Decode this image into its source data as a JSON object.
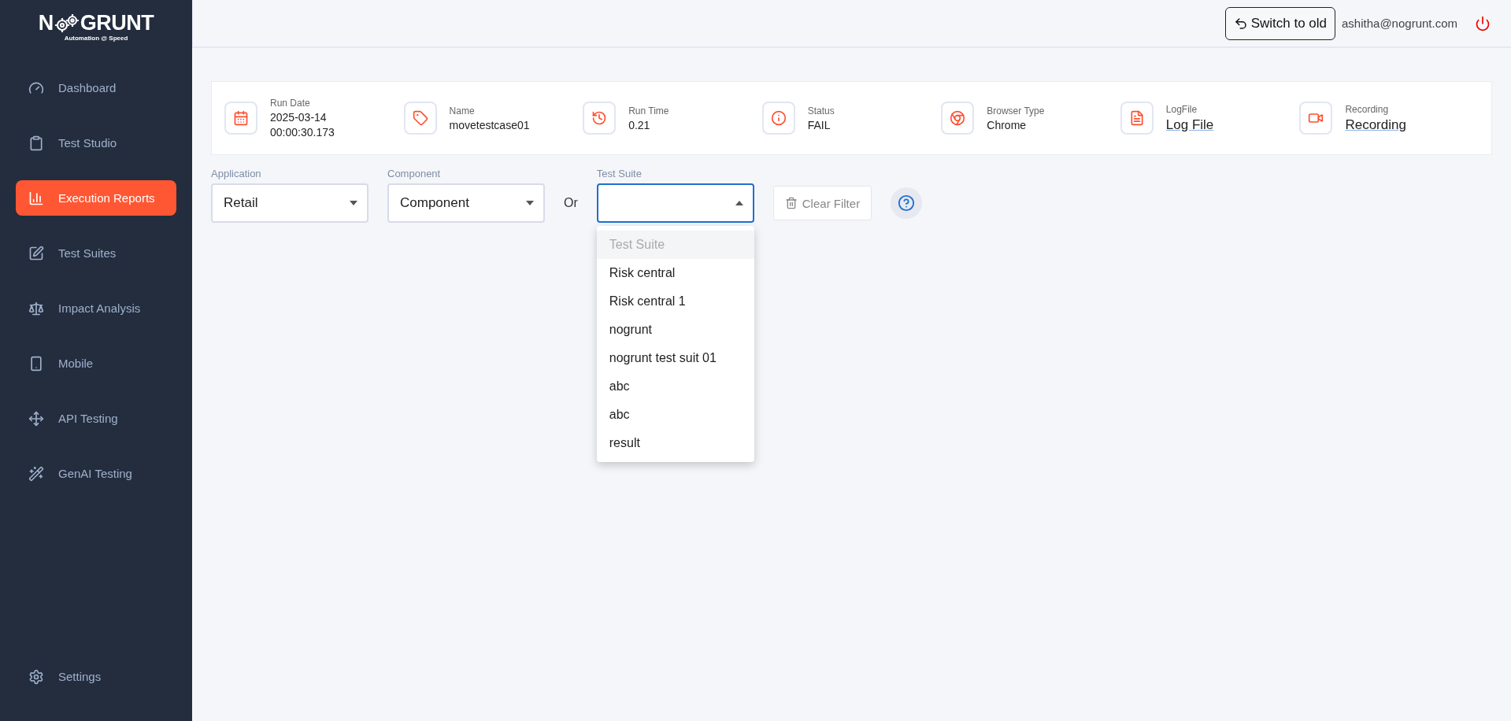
{
  "logo": {
    "left": "N",
    "right": "GRUNT",
    "tagline": "Automation @ Speed"
  },
  "sidebar": {
    "items": [
      {
        "label": "Dashboard",
        "selected": false
      },
      {
        "label": "Test Studio",
        "selected": false
      },
      {
        "label": "Execution Reports",
        "selected": true
      },
      {
        "label": "Test Suites",
        "selected": false
      },
      {
        "label": "Impact Analysis",
        "selected": false
      },
      {
        "label": "Mobile",
        "selected": false
      },
      {
        "label": "API Testing",
        "selected": false
      },
      {
        "label": "GenAI Testing",
        "selected": false
      }
    ],
    "footer_item": {
      "label": "Settings",
      "selected": false
    }
  },
  "topbar": {
    "switch_button": "Switch to old",
    "user_email": "ashitha@nogrunt.com"
  },
  "run_info": [
    {
      "label": "Run Date",
      "lines": [
        "2025-03-14",
        "00:00:30.173"
      ],
      "kind": "text"
    },
    {
      "label": "Name",
      "lines": [
        "movetestcase01"
      ],
      "kind": "text"
    },
    {
      "label": "Run Time",
      "lines": [
        "0.21"
      ],
      "kind": "text"
    },
    {
      "label": "Status",
      "lines": [
        "FAIL"
      ],
      "kind": "text"
    },
    {
      "label": "Browser Type",
      "lines": [
        "Chrome"
      ],
      "kind": "text"
    },
    {
      "label": "LogFile",
      "lines": [
        "Log File"
      ],
      "kind": "link"
    },
    {
      "label": "Recording",
      "lines": [
        "Recording"
      ],
      "kind": "link"
    }
  ],
  "filters": {
    "selects": [
      {
        "label": "Application",
        "value": "Retail",
        "expanded": false
      },
      {
        "label": "Component",
        "value": "Component",
        "expanded": false
      },
      {
        "label": "Test Suite",
        "expanded": true
      }
    ],
    "separator": "Or",
    "clear_button": "Clear Filter",
    "dropdown_options": [
      {
        "label": "Test Suite",
        "disabled": true
      },
      {
        "label": "Risk central",
        "disabled": false
      },
      {
        "label": "Risk central 1",
        "disabled": false
      },
      {
        "label": "nogrunt",
        "disabled": false
      },
      {
        "label": "nogrunt test suit 01",
        "disabled": false
      },
      {
        "label": "abc",
        "disabled": false
      },
      {
        "label": "abc",
        "disabled": false
      },
      {
        "label": "result",
        "disabled": false
      }
    ]
  }
}
